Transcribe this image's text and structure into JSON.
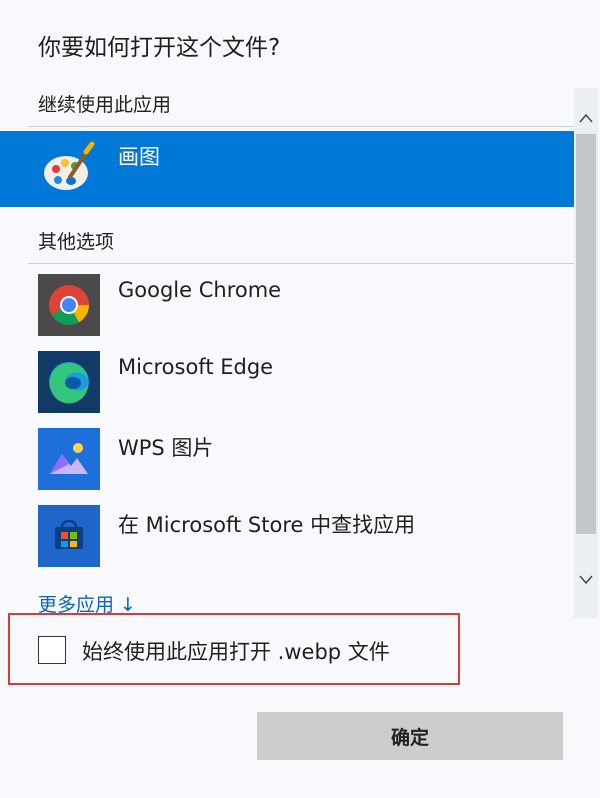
{
  "dialog": {
    "title": "你要如何打开这个文件?",
    "continue_section": "继续使用此应用",
    "other_section": "其他选项",
    "current_app": {
      "name": "画图",
      "icon": "paint-palette-icon"
    },
    "other_apps": [
      {
        "name": "Google Chrome",
        "icon": "chrome-icon"
      },
      {
        "name": "Microsoft Edge",
        "icon": "edge-icon"
      },
      {
        "name": "WPS 图片",
        "icon": "wps-pictures-icon"
      },
      {
        "name": "在 Microsoft Store 中查找应用",
        "icon": "microsoft-store-icon"
      }
    ],
    "more_apps": "更多应用 ↓",
    "always_use_label": "始终使用此应用打开 .webp 文件",
    "always_use_checked": false,
    "ok_label": "确定"
  },
  "colors": {
    "accent": "#0078d7",
    "link": "#0a63c2",
    "highlight_border": "#d93a3a",
    "button_bg": "#cdcdcd"
  }
}
